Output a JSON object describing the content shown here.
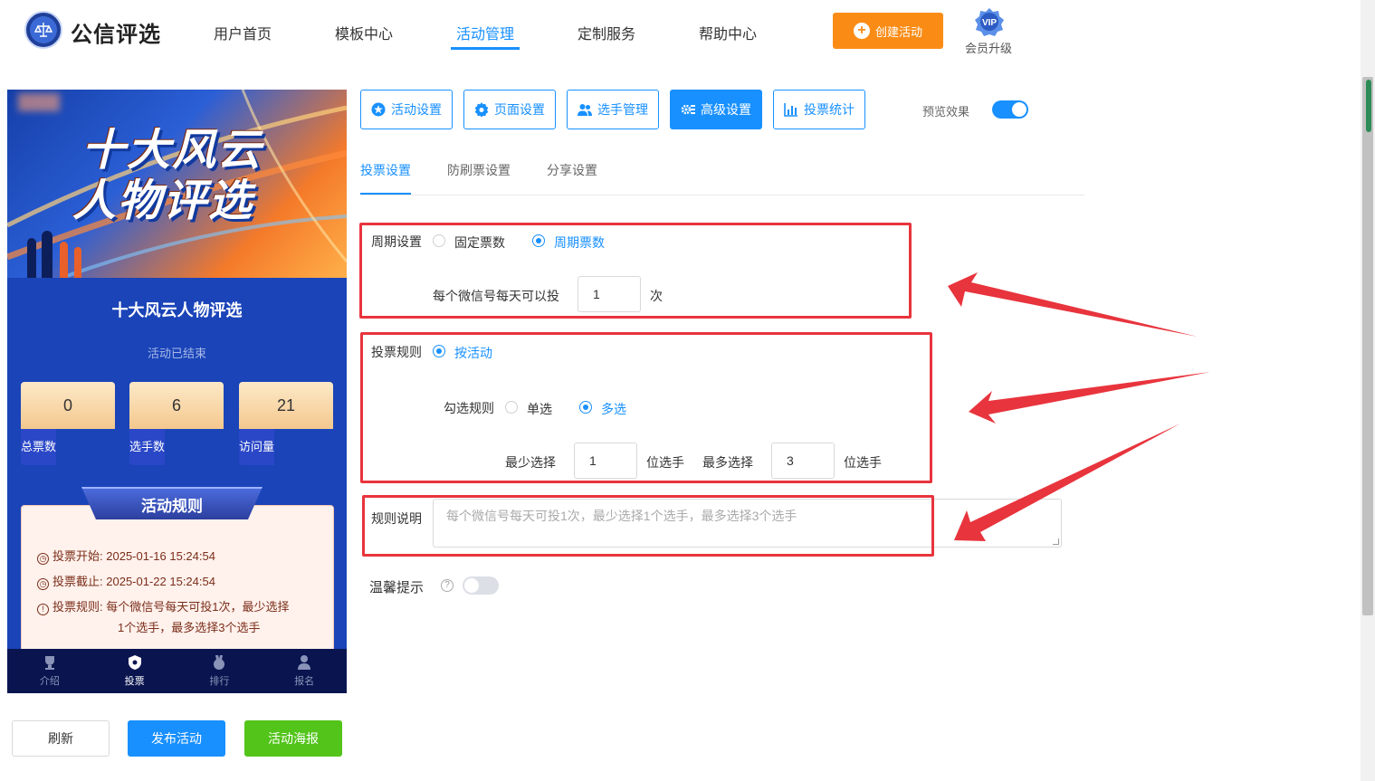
{
  "app": {
    "brand": "公信评选",
    "nav": [
      "用户首页",
      "模板中心",
      "活动管理",
      "定制服务",
      "帮助中心"
    ],
    "nav_active_index": 2,
    "create_button": "创建活动",
    "vip_badge": "VIP",
    "vip_label": "会员升级"
  },
  "colors": {
    "primary": "#1890ff",
    "orange": "#fa8c16",
    "green": "#52c41a",
    "annotation_red": "#e8343d"
  },
  "preview": {
    "banner_title_line1": "十大风云",
    "banner_title_line2": "人物评选",
    "activity_title": "十大风云人物评选",
    "activity_status": "活动已结束",
    "stats": [
      {
        "value": "0",
        "label": "总票数"
      },
      {
        "value": "6",
        "label": "选手数"
      },
      {
        "value": "21",
        "label": "访问量"
      }
    ],
    "rules_title": "活动规则",
    "rule_lines": [
      {
        "icon": "clock-icon",
        "label": "投票开始:",
        "value": "2025-01-16 15:24:54"
      },
      {
        "icon": "clock-icon",
        "label": "投票截止:",
        "value": "2025-01-22 15:24:54"
      },
      {
        "icon": "info-icon",
        "label": "投票规则:",
        "value": "每个微信号每天可投1次，最少选择",
        "value2": "1个选手，最多选择3个选手"
      }
    ],
    "tabs": [
      {
        "label": "介绍",
        "icon": "trophy-icon"
      },
      {
        "label": "投票",
        "icon": "shield-icon"
      },
      {
        "label": "排行",
        "icon": "medal-icon"
      },
      {
        "label": "报名",
        "icon": "user-icon"
      }
    ],
    "tab_active_index": 1
  },
  "actions": {
    "refresh": "刷新",
    "publish": "发布活动",
    "poster": "活动海报"
  },
  "toolbar": {
    "buttons": [
      {
        "label": "活动设置",
        "icon": "star-icon"
      },
      {
        "label": "页面设置",
        "icon": "gear-icon"
      },
      {
        "label": "选手管理",
        "icon": "users-icon"
      },
      {
        "label": "高级设置",
        "icon": "settings-icon"
      },
      {
        "label": "投票统计",
        "icon": "bar-chart-icon"
      }
    ],
    "active_index": 3,
    "preview_label": "预览效果",
    "preview_on": true
  },
  "subtabs": [
    "投票设置",
    "防刷票设置",
    "分享设置"
  ],
  "subtab_active_index": 0,
  "settings": {
    "period_label": "周期设置",
    "period_options": [
      "固定票数",
      "周期票数"
    ],
    "period_selected": 1,
    "daily_label": "每个微信号每天可以投",
    "daily_value": "1",
    "daily_unit": "次",
    "rule_label": "投票规则",
    "rule_option": "按活动",
    "check_label": "勾选规则",
    "check_options": [
      "单选",
      "多选"
    ],
    "check_selected": 1,
    "min_label": "最少选择",
    "min_value": "1",
    "min_unit": "位选手",
    "max_label": "最多选择",
    "max_value": "3",
    "max_unit": "位选手",
    "desc_label": "规则说明",
    "desc_placeholder": "每个微信号每天可投1次，最少选择1个选手，最多选择3个选手",
    "tip_label": "温馨提示",
    "tip_on": false
  }
}
